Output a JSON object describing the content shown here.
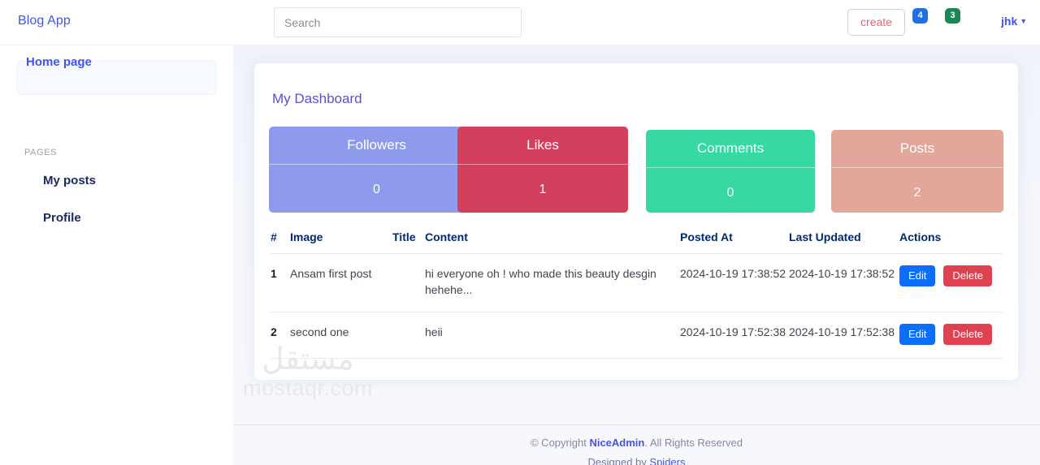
{
  "header": {
    "brand": "Blog App",
    "search": {
      "placeholder": "Search",
      "value": ""
    },
    "create_label": "create",
    "badges": [
      {
        "name": "messages",
        "count": "4",
        "color": "#1f6fe5"
      },
      {
        "name": "notifications",
        "count": "3",
        "color": "#1a8754"
      }
    ],
    "user": {
      "label": "jhk",
      "caret": "▼"
    }
  },
  "sidebar": {
    "active_item": {
      "label": "Home page"
    },
    "section_heading": "PAGES",
    "items": [
      {
        "label": "My posts"
      },
      {
        "label": "Profile"
      }
    ]
  },
  "main": {
    "card_title": "My Dashboard",
    "stats": [
      {
        "label": "Followers",
        "value": "0",
        "color": "#8e9aec"
      },
      {
        "label": "Likes",
        "value": "1",
        "color": "#d43f5e"
      },
      {
        "label": "Comments",
        "value": "0",
        "color": "#36d9a0"
      },
      {
        "label": "Posts",
        "value": "2",
        "color": "#e3a69b"
      }
    ],
    "table": {
      "headers": [
        "#",
        "Image",
        "Title",
        "Content",
        "Posted At",
        "Last Updated",
        "Actions"
      ],
      "rows": [
        {
          "index": "1",
          "image": "Ansam first post",
          "title": "",
          "content": "hi everyone oh ! who made this beauty desgin hehehe...",
          "posted_at": "2024-10-19 17:38:52",
          "last_updated": "2024-10-19 17:38:52",
          "edit_label": "Edit",
          "delete_label": "Delete"
        },
        {
          "index": "2",
          "image": "second one",
          "title": "",
          "content": "heii",
          "posted_at": "2024-10-19 17:52:38",
          "last_updated": "2024-10-19 17:52:38",
          "edit_label": "Edit",
          "delete_label": "Delete"
        }
      ]
    }
  },
  "footer": {
    "copyright_prefix": "© Copyright ",
    "copyright_brand": "NiceAdmin",
    "copyright_suffix": ". All Rights Reserved",
    "credits_prefix": "Designed by ",
    "credits_link": "Spiders"
  },
  "watermark": {
    "arabic": "مستقل",
    "latin": "mostaqr.com"
  }
}
